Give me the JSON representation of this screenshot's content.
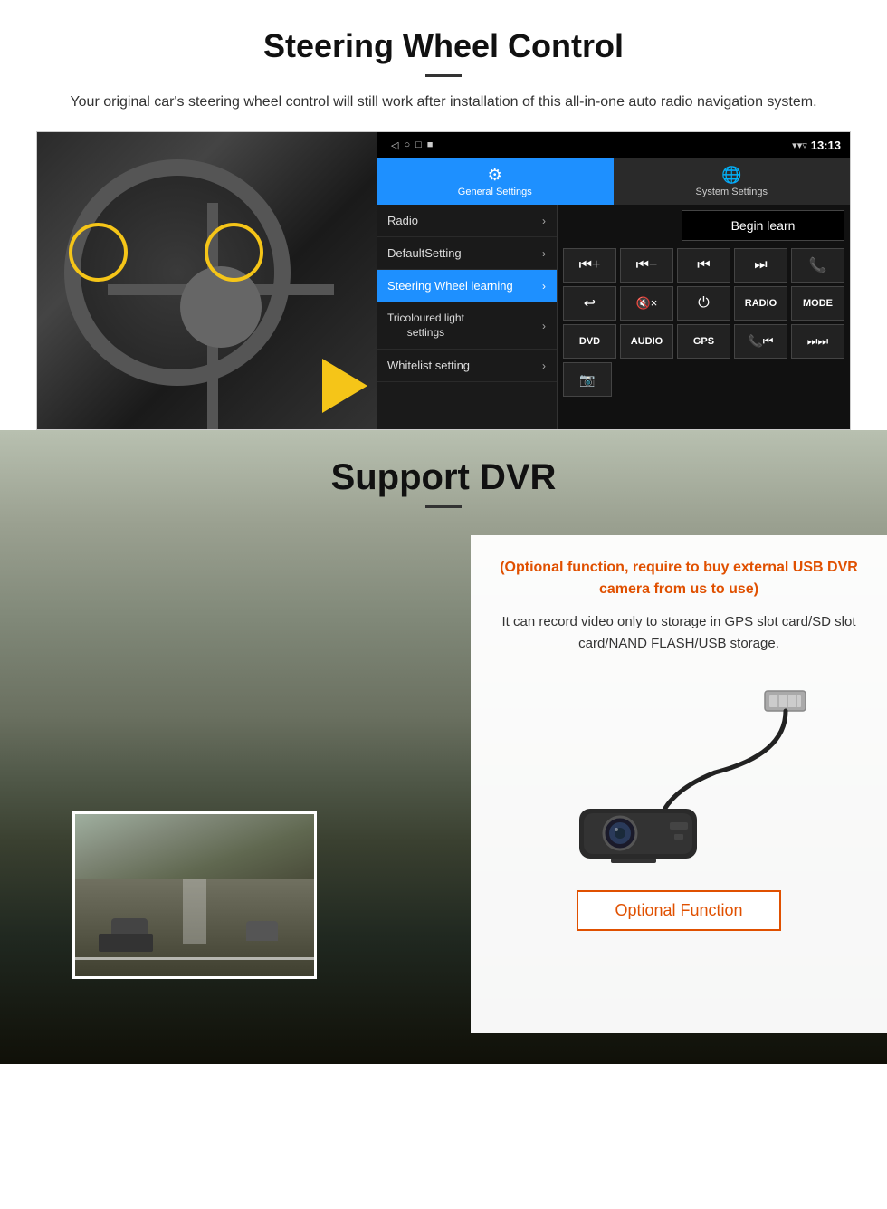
{
  "steering": {
    "title": "Steering Wheel Control",
    "subtitle": "Your original car's steering wheel control will still work after installation of this all-in-one auto radio navigation system.",
    "statusbar": {
      "time": "13:13",
      "icons": [
        "◁",
        "○",
        "□",
        "■"
      ]
    },
    "tabs": [
      {
        "icon": "⚙",
        "label": "General Settings",
        "active": true
      },
      {
        "icon": "🌐",
        "label": "System Settings",
        "active": false
      }
    ],
    "menu": [
      {
        "label": "Radio",
        "active": false
      },
      {
        "label": "DefaultSetting",
        "active": false
      },
      {
        "label": "Steering Wheel learning",
        "active": true
      },
      {
        "label": "Tricoloured light settings",
        "active": false
      },
      {
        "label": "Whitelist setting",
        "active": false
      }
    ],
    "begin_learn": "Begin learn",
    "control_buttons": [
      [
        "⏮+",
        "⏮-",
        "⏮⏮",
        "⏭⏭",
        "📞"
      ],
      [
        "↩",
        "🔇x",
        "⏻",
        "RADIO",
        "MODE"
      ],
      [
        "DVD",
        "AUDIO",
        "GPS",
        "📞⏮",
        "⏭⏭"
      ]
    ],
    "bottom_icon": "🎦"
  },
  "dvr": {
    "title": "Support DVR",
    "card_orange": "(Optional function, require to buy external USB DVR camera from us to use)",
    "card_text": "It can record video only to storage in GPS slot card/SD slot card/NAND FLASH/USB storage.",
    "optional_function_label": "Optional Function"
  }
}
